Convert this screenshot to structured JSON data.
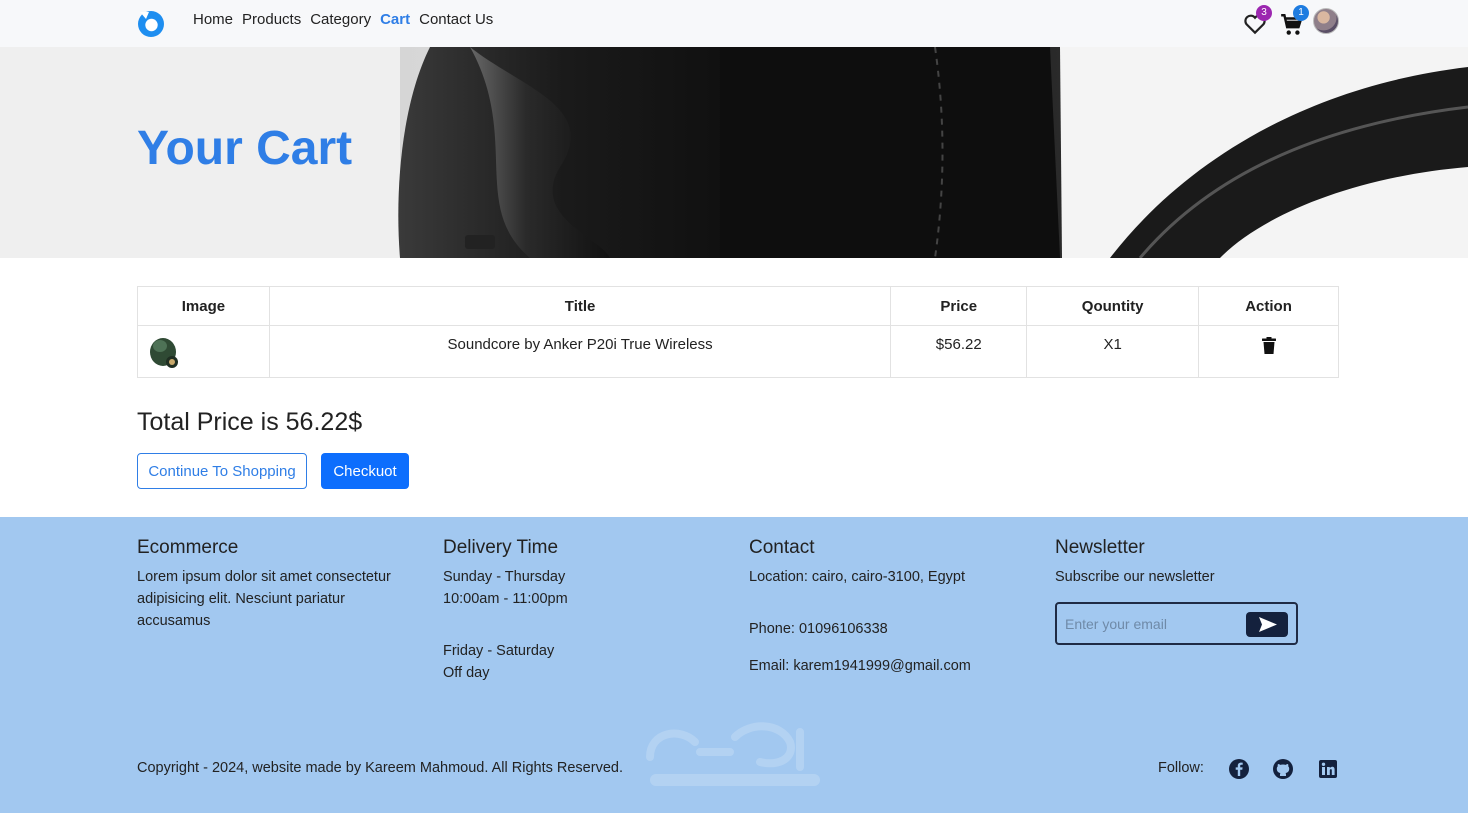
{
  "nav": {
    "links": [
      "Home",
      "Products",
      "Category",
      "Cart",
      "Contact Us"
    ],
    "active": "Cart",
    "wishlist_count": "3",
    "cart_count": "1",
    "icons": [
      "logo-icon",
      "heart-icon",
      "cart-icon",
      "avatar"
    ]
  },
  "hero": {
    "title": "Your Cart"
  },
  "table": {
    "headers": [
      "Image",
      "Title",
      "Price",
      "Qountity",
      "Action"
    ],
    "rows": [
      {
        "title": "Soundcore by Anker P20i True Wireless",
        "price": "$56.22",
        "quantity": "X1",
        "action_icon": "trash-icon"
      }
    ]
  },
  "summary": {
    "total": "Total Price is 56.22$",
    "continue_label": "Continue To Shopping",
    "checkout_label": "Checkuot"
  },
  "footer": {
    "about": {
      "title": "Ecommerce",
      "text": "Lorem ipsum dolor sit amet consectetur adipisicing elit. Nesciunt pariatur accusamus"
    },
    "delivery": {
      "title": "Delivery Time",
      "line1": "Sunday - Thursday",
      "line2": "10:00am - 11:00pm",
      "line3": "Friday - Saturday",
      "line4": "Off day"
    },
    "contact": {
      "title": "Contact",
      "location": "Location: cairo, cairo-3100, Egypt",
      "phone": "Phone: 01096106338",
      "email": "Email: karem1941999@gmail.com"
    },
    "newsletter": {
      "title": "Newsletter",
      "subtitle": "Subscribe our newsletter",
      "placeholder": "Enter your email"
    },
    "copyright": "Copyright - 2024, website made by Kareem Mahmoud. All Rights Reserved.",
    "follow": "Follow:",
    "social_icons": [
      "facebook-icon",
      "github-icon",
      "linkedin-icon"
    ]
  },
  "colors": {
    "accent": "#2f7ee6",
    "primary": "#0d6efd",
    "footer_bg": "#a2c8f0",
    "badge": "#9c27b0"
  }
}
